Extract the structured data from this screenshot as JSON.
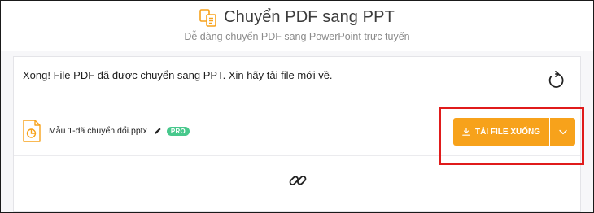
{
  "header": {
    "title": "Chuyển PDF sang PPT",
    "subtitle": "Dễ dàng chuyển PDF sang PowerPoint trực tuyến",
    "logo_icon": "pdf-to-ppt-icon"
  },
  "result": {
    "message": "Xong! File PDF đã được chuyển sang PPT. Xin hãy tải file mới về.",
    "restart_icon": "restart-icon"
  },
  "file": {
    "name": "Mẫu 1-đã chuyển đổi.pptx",
    "icon": "pptx-file-icon",
    "edit_icon": "pencil-icon",
    "badge": "PRO"
  },
  "download": {
    "label": "TẢI FILE XUỐNG",
    "icon": "download-icon",
    "caret_icon": "chevron-down-icon"
  },
  "share": {
    "icon": "link-icon"
  },
  "colors": {
    "accent": "#f7a21b",
    "badge": "#47c88c",
    "annotation": "#e01b1b"
  }
}
